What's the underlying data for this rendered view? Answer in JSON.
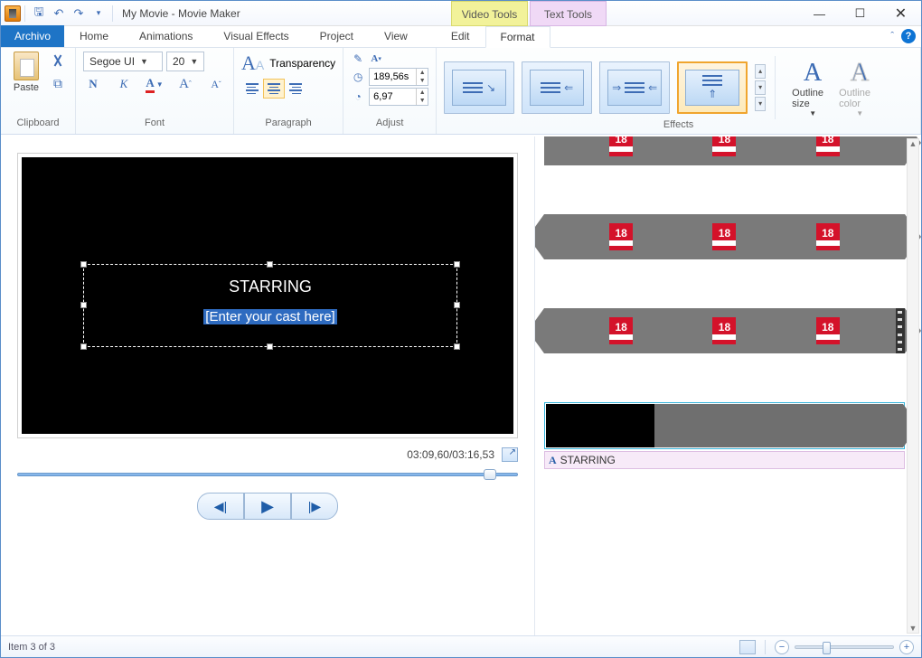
{
  "titlebar": {
    "title": "My Movie - Movie Maker",
    "ctx_video": "Video Tools",
    "ctx_text": "Text Tools"
  },
  "tabs": {
    "file": "Archivo",
    "home": "Home",
    "animations": "Animations",
    "visual_effects": "Visual Effects",
    "project": "Project",
    "view": "View",
    "edit": "Edit",
    "format": "Format"
  },
  "ribbon": {
    "clipboard": {
      "paste": "Paste",
      "label": "Clipboard"
    },
    "font": {
      "name": "Segoe UI",
      "size": "20",
      "bold": "N",
      "italic": "K",
      "color_label": "A",
      "grow": "A",
      "shrink": "A",
      "label": "Font"
    },
    "paragraph": {
      "transparency": "Transparency",
      "label": "Paragraph"
    },
    "adjust": {
      "time1": "189,56s",
      "time2": "6,97",
      "label": "Adjust"
    },
    "effects": {
      "label": "Effects"
    },
    "outline": {
      "size": "Outline size",
      "color": "Outline color"
    }
  },
  "preview": {
    "text_title": "STARRING",
    "placeholder": "[Enter your cast here]",
    "timecode": "03:09,60/03:16,53"
  },
  "timeline": {
    "badge": "18",
    "caption": "STARRING"
  },
  "status": {
    "item": "Item 3 of 3"
  }
}
